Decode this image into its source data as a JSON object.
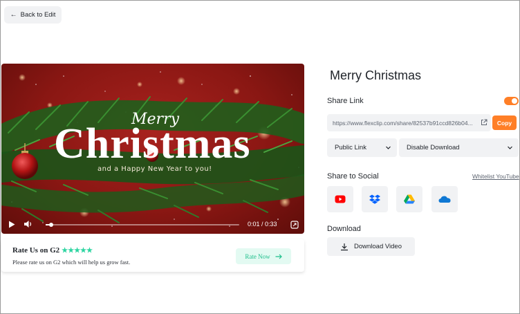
{
  "header": {
    "back_label": "Back to Edit"
  },
  "video": {
    "title_script": "Merry",
    "title_main": "Christmas",
    "subtitle": "and a Happy New Year to you!",
    "time": "0:01 / 0:33",
    "progress": 0.03
  },
  "rate": {
    "title": "Rate Us on G2",
    "stars": "★★★★★",
    "description": "Please rate us on G2 which will help us grow fast.",
    "button_label": "Rate Now"
  },
  "panel": {
    "project_title": "Merry Christmas",
    "share_link_label": "Share Link",
    "share_link_enabled": true,
    "share_url": "https://www.flexclip.com/share/82537b91ccd826b04...",
    "copy_label": "Copy",
    "privacy_value": "Public Link",
    "download_permission_value": "Disable Download",
    "share_social_label": "Share to Social",
    "whitelist_label": "Whitelist YouTube",
    "social_icons": [
      "youtube-icon",
      "dropbox-icon",
      "google-drive-icon",
      "onedrive-icon"
    ],
    "download_section_label": "Download",
    "download_button_label": "Download Video"
  },
  "colors": {
    "accent": "#ff7f27",
    "rate_green": "#1fbf8c",
    "video_bg": "#8a1713"
  }
}
